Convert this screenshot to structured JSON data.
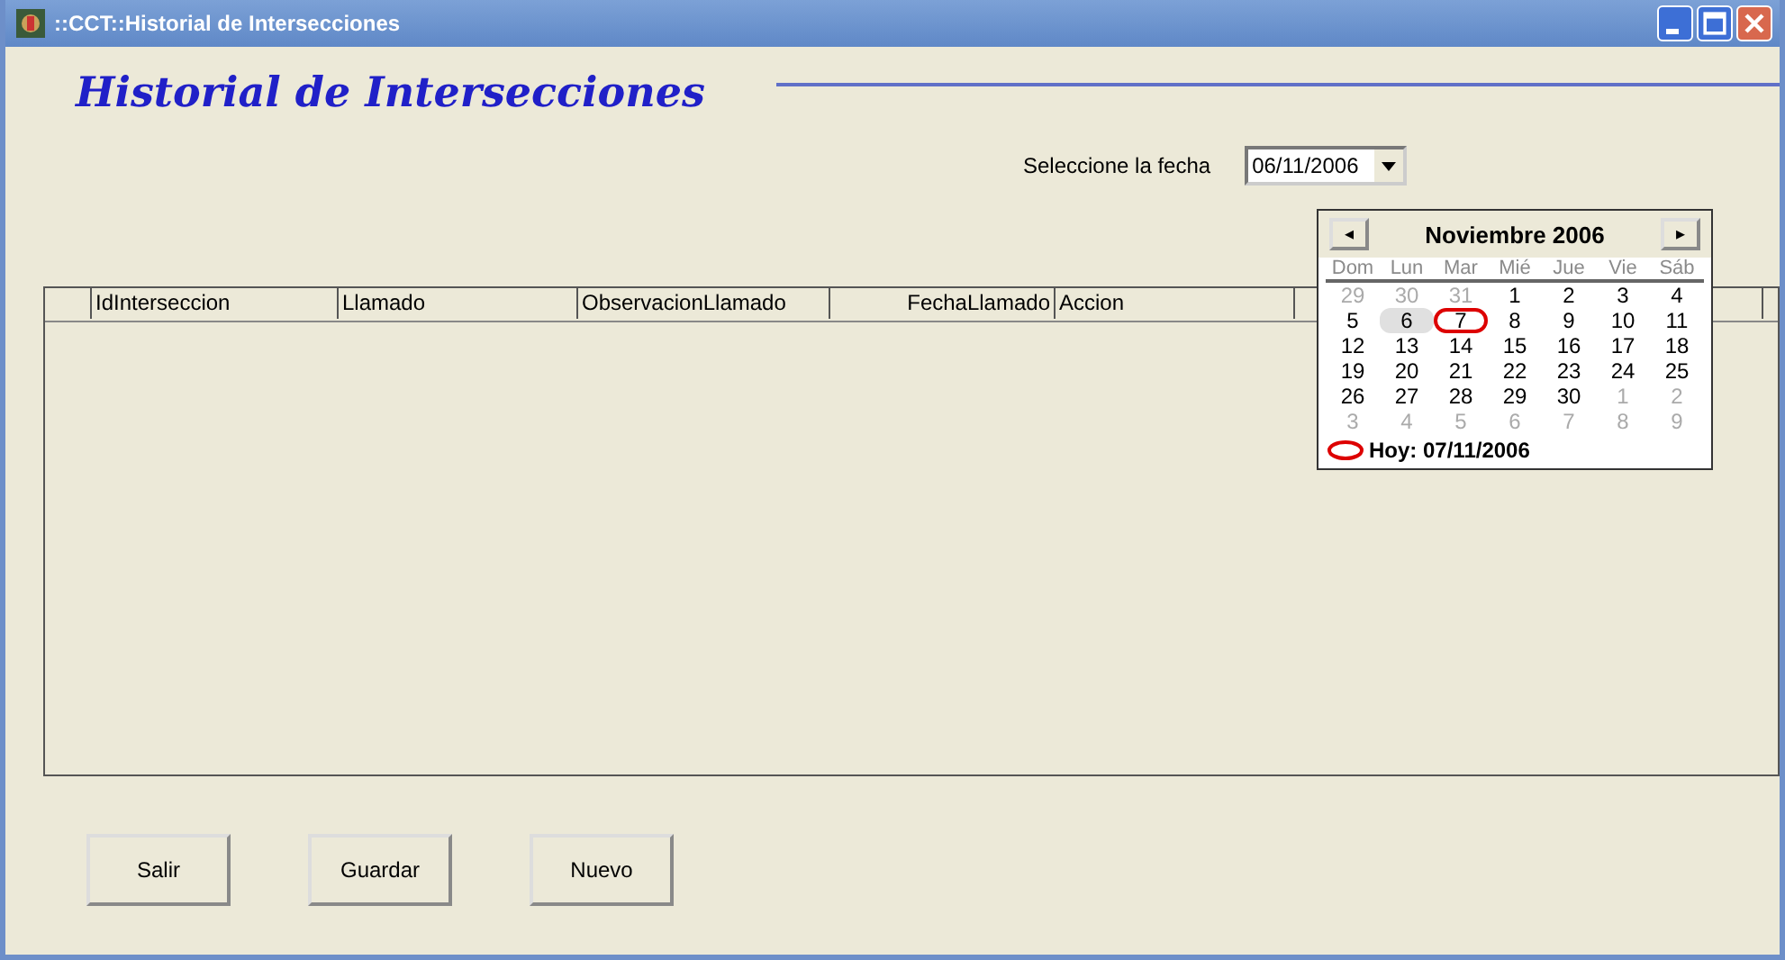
{
  "window": {
    "title": "::CCT::Historial de Intersecciones"
  },
  "heading": "Historial de Intersecciones",
  "date_picker": {
    "label": "Seleccione la fecha",
    "value": "06/11/2006"
  },
  "table": {
    "columns": [
      {
        "label": "IdInterseccion",
        "right_aligned": false
      },
      {
        "label": "Llamado",
        "right_aligned": false
      },
      {
        "label": "ObservacionLlamado",
        "right_aligned": false
      },
      {
        "label": "FechaLlamado",
        "right_aligned": true
      },
      {
        "label": "Accion",
        "right_aligned": false
      }
    ]
  },
  "calendar": {
    "prev": "◂",
    "next": "▸",
    "month": "Noviembre 2006",
    "weekdays": [
      "Dom",
      "Lun",
      "Mar",
      "Mié",
      "Jue",
      "Vie",
      "Sáb"
    ],
    "weeks": [
      [
        {
          "day": "29",
          "other_month": true,
          "selected": false,
          "today": false
        },
        {
          "day": "30",
          "other_month": true,
          "selected": false,
          "today": false
        },
        {
          "day": "31",
          "other_month": true,
          "selected": false,
          "today": false
        },
        {
          "day": "1",
          "other_month": false,
          "selected": false,
          "today": false
        },
        {
          "day": "2",
          "other_month": false,
          "selected": false,
          "today": false
        },
        {
          "day": "3",
          "other_month": false,
          "selected": false,
          "today": false
        },
        {
          "day": "4",
          "other_month": false,
          "selected": false,
          "today": false
        }
      ],
      [
        {
          "day": "5",
          "other_month": false,
          "selected": false,
          "today": false
        },
        {
          "day": "6",
          "other_month": false,
          "selected": true,
          "today": false
        },
        {
          "day": "7",
          "other_month": false,
          "selected": false,
          "today": true
        },
        {
          "day": "8",
          "other_month": false,
          "selected": false,
          "today": false
        },
        {
          "day": "9",
          "other_month": false,
          "selected": false,
          "today": false
        },
        {
          "day": "10",
          "other_month": false,
          "selected": false,
          "today": false
        },
        {
          "day": "11",
          "other_month": false,
          "selected": false,
          "today": false
        }
      ],
      [
        {
          "day": "12",
          "other_month": false,
          "selected": false,
          "today": false
        },
        {
          "day": "13",
          "other_month": false,
          "selected": false,
          "today": false
        },
        {
          "day": "14",
          "other_month": false,
          "selected": false,
          "today": false
        },
        {
          "day": "15",
          "other_month": false,
          "selected": false,
          "today": false
        },
        {
          "day": "16",
          "other_month": false,
          "selected": false,
          "today": false
        },
        {
          "day": "17",
          "other_month": false,
          "selected": false,
          "today": false
        },
        {
          "day": "18",
          "other_month": false,
          "selected": false,
          "today": false
        }
      ],
      [
        {
          "day": "19",
          "other_month": false,
          "selected": false,
          "today": false
        },
        {
          "day": "20",
          "other_month": false,
          "selected": false,
          "today": false
        },
        {
          "day": "21",
          "other_month": false,
          "selected": false,
          "today": false
        },
        {
          "day": "22",
          "other_month": false,
          "selected": false,
          "today": false
        },
        {
          "day": "23",
          "other_month": false,
          "selected": false,
          "today": false
        },
        {
          "day": "24",
          "other_month": false,
          "selected": false,
          "today": false
        },
        {
          "day": "25",
          "other_month": false,
          "selected": false,
          "today": false
        }
      ],
      [
        {
          "day": "26",
          "other_month": false,
          "selected": false,
          "today": false
        },
        {
          "day": "27",
          "other_month": false,
          "selected": false,
          "today": false
        },
        {
          "day": "28",
          "other_month": false,
          "selected": false,
          "today": false
        },
        {
          "day": "29",
          "other_month": false,
          "selected": false,
          "today": false
        },
        {
          "day": "30",
          "other_month": false,
          "selected": false,
          "today": false
        },
        {
          "day": "1",
          "other_month": true,
          "selected": false,
          "today": false
        },
        {
          "day": "2",
          "other_month": true,
          "selected": false,
          "today": false
        }
      ],
      [
        {
          "day": "3",
          "other_month": true,
          "selected": false,
          "today": false
        },
        {
          "day": "4",
          "other_month": true,
          "selected": false,
          "today": false
        },
        {
          "day": "5",
          "other_month": true,
          "selected": false,
          "today": false
        },
        {
          "day": "6",
          "other_month": true,
          "selected": false,
          "today": false
        },
        {
          "day": "7",
          "other_month": true,
          "selected": false,
          "today": false
        },
        {
          "day": "8",
          "other_month": true,
          "selected": false,
          "today": false
        },
        {
          "day": "9",
          "other_month": true,
          "selected": false,
          "today": false
        }
      ]
    ],
    "today_label": "Hoy: 07/11/2006"
  },
  "buttons": [
    "Salir",
    "Guardar",
    "Nuevo"
  ]
}
